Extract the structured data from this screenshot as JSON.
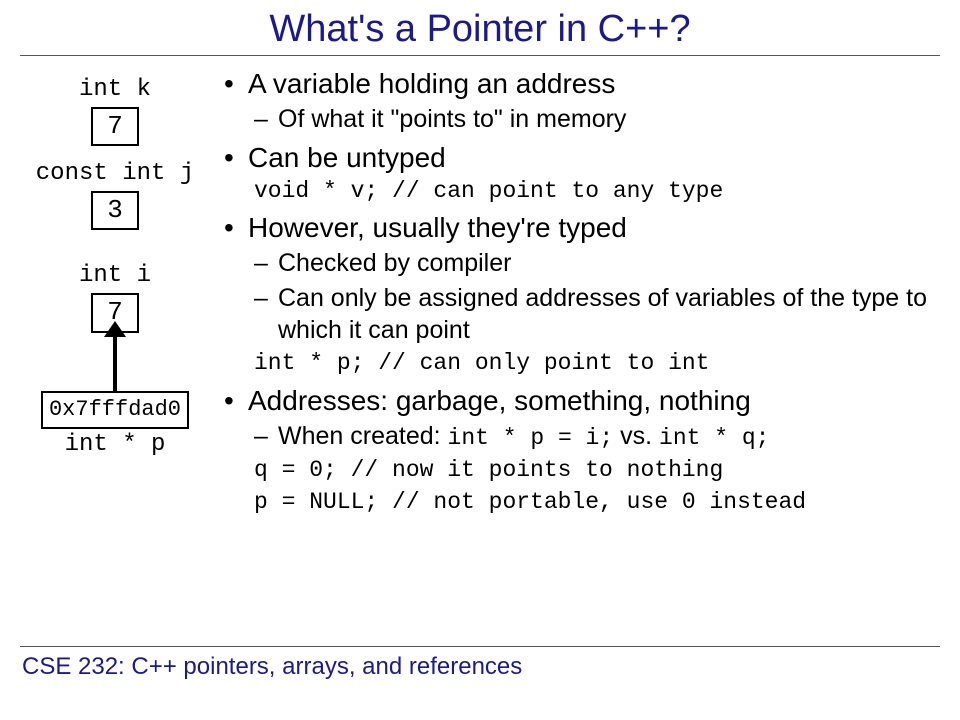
{
  "title": "What's a Pointer in C++?",
  "left": {
    "k_label": "int k",
    "k_value": "7",
    "j_label": "const int j",
    "j_value": "3",
    "i_label": "int i",
    "i_value": "7",
    "p_value": "0x7fffdad0",
    "p_label": "int * p"
  },
  "bullets": {
    "b1": "A variable holding an address",
    "b1s1": "Of what it \"points to\" in memory",
    "b2": "Can be untyped",
    "b2c": "void * v; // can point to any type",
    "b3": "However, usually they're typed",
    "b3s1": "Checked by compiler",
    "b3s2": "Can only be assigned addresses of variables of the type to which it can point",
    "b3c": "int * p; // can only point to int",
    "b4": "Addresses: garbage, something, nothing",
    "b4s1_pre": "When created: ",
    "b4s1_c1": "int * p = i;",
    "b4s1_mid": " vs. ",
    "b4s1_c2": "int * q;",
    "b4c1": "q = 0; // now it points to nothing",
    "b4c2": "p = NULL; // not portable, use 0 instead"
  },
  "footer": "CSE 232: C++ pointers, arrays, and references"
}
